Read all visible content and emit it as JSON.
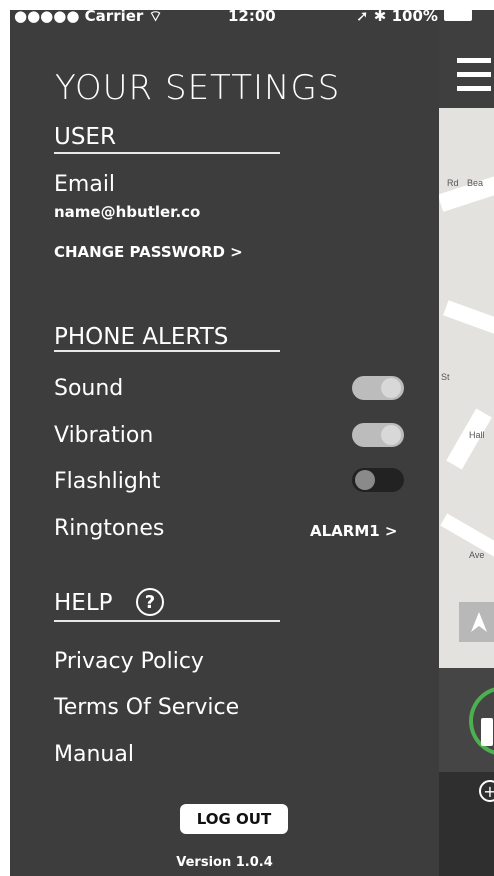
{
  "status_bar": {
    "carrier": "●●●●● Carrier ⌔",
    "time": "12:00",
    "right": "➚ ✱ 100%"
  },
  "settings": {
    "title": "YOUR SETTINGS",
    "user": {
      "heading": "USER",
      "email_label": "Email",
      "email_value": "name@hbutler.co",
      "change_password": "CHANGE PASSWORD >"
    },
    "phone_alerts": {
      "heading": "PHONE ALERTS",
      "items": [
        {
          "label": "Sound",
          "state": "on"
        },
        {
          "label": "Vibration",
          "state": "on"
        },
        {
          "label": "Flashlight",
          "state": "off"
        }
      ],
      "ringtones_label": "Ringtones",
      "ringtones_value": "ALARM1 >"
    },
    "help": {
      "heading": "HELP",
      "help_icon": "question-circle-icon",
      "items": [
        "Privacy Policy",
        "Terms Of Service",
        "Manual"
      ]
    },
    "logout_label": "LOG OUT",
    "version": "Version 1.0.4"
  },
  "map": {
    "menu_icon": "hamburger-icon",
    "location_icon": "location-arrow-icon",
    "labels": [
      "Rd",
      "Bea",
      "Hall",
      "Ave",
      "St"
    ]
  }
}
